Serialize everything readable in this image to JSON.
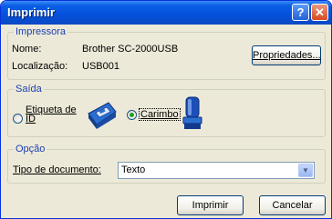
{
  "window": {
    "title": "Imprimir"
  },
  "titlebar": {
    "help_glyph": "?",
    "close_glyph": "✕"
  },
  "impressora": {
    "legend": "Impressora",
    "nome_label": "Nome:",
    "nome_value": "Brother SC-2000USB",
    "localizacao_label": "Localização:",
    "localizacao_value": "USB001",
    "propriedades_label": "Propriedades..."
  },
  "saida": {
    "legend": "Saída",
    "option_etiqueta_line1": "Etiqueta de",
    "option_etiqueta_line2": "ID",
    "option_etiqueta_selected": false,
    "option_carimbo": "Carimbo",
    "option_carimbo_selected": true
  },
  "opcao": {
    "legend": "Opção",
    "tipo_label": "Tipo de documento:",
    "tipo_value": "Texto"
  },
  "footer": {
    "imprimir_label": "Imprimir",
    "cancelar_label": "Cancelar"
  }
}
